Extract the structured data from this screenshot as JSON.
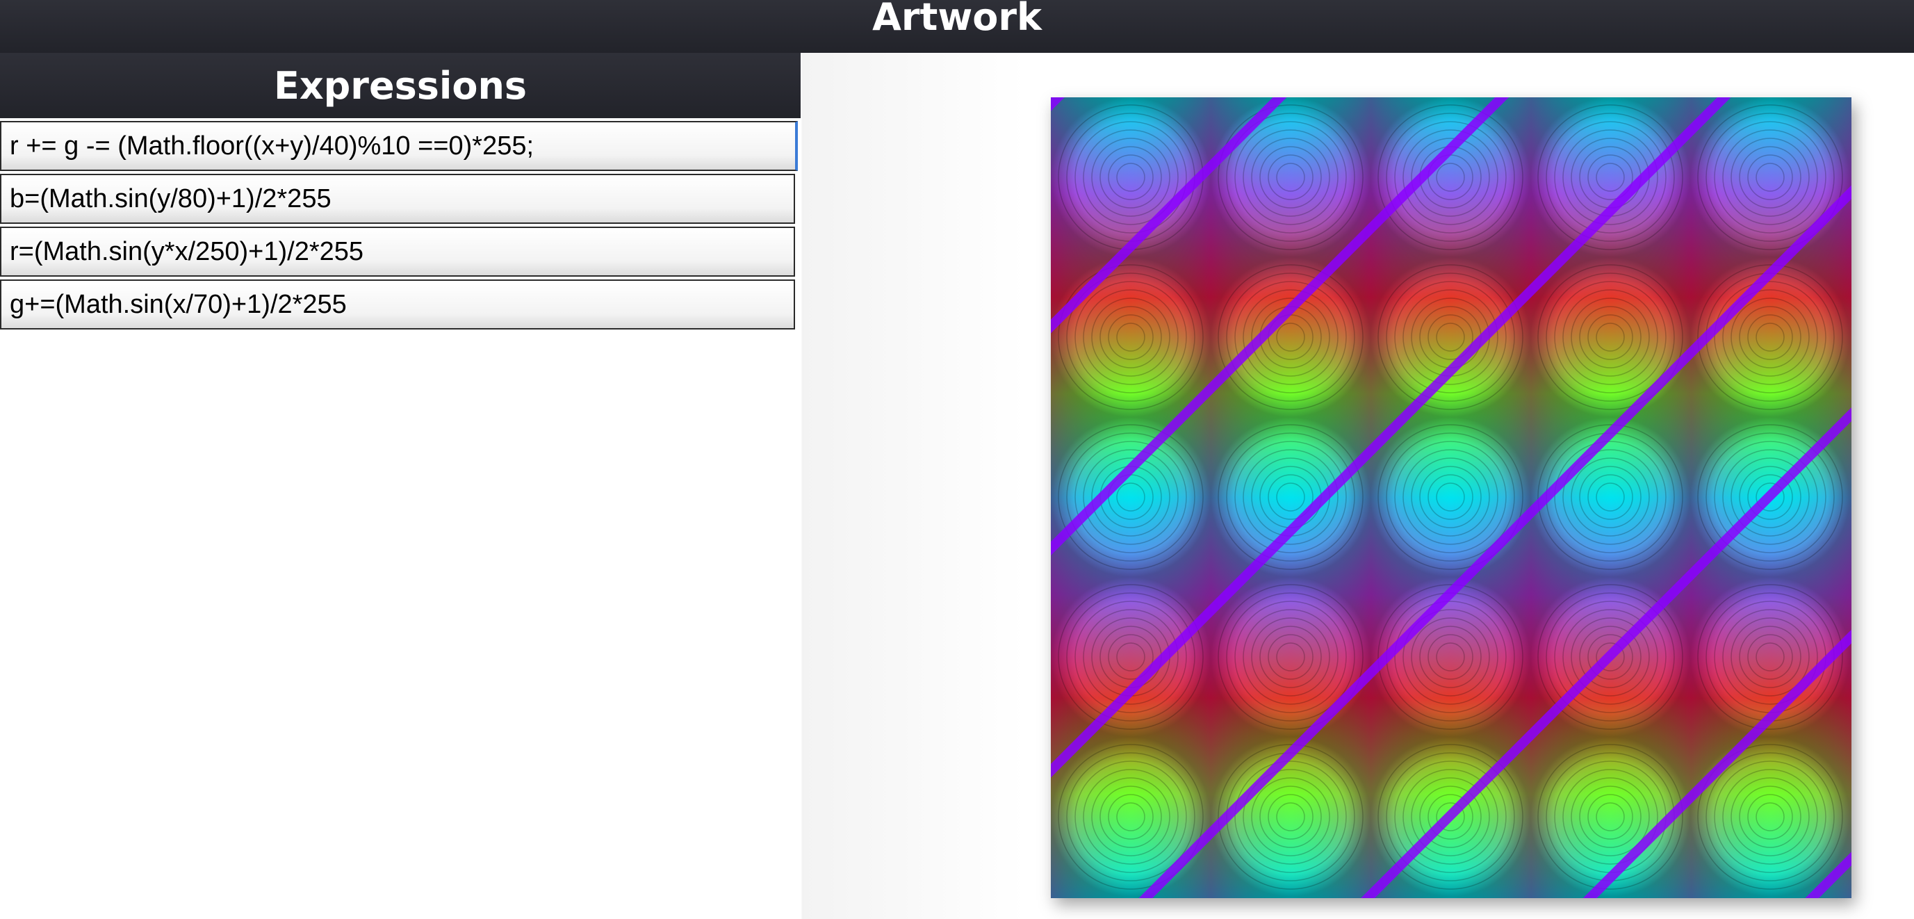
{
  "header": {
    "title": "Artwork"
  },
  "expressions_panel": {
    "title": "Expressions",
    "items": [
      "r += g -= (Math.floor((x+y)/40)%10 ==0)*255;",
      "b=(Math.sin(y/80)+1)/2*255",
      "r=(Math.sin(y*x/250)+1)/2*255",
      "g+=(Math.sin(x/70)+1)/2*255"
    ]
  }
}
